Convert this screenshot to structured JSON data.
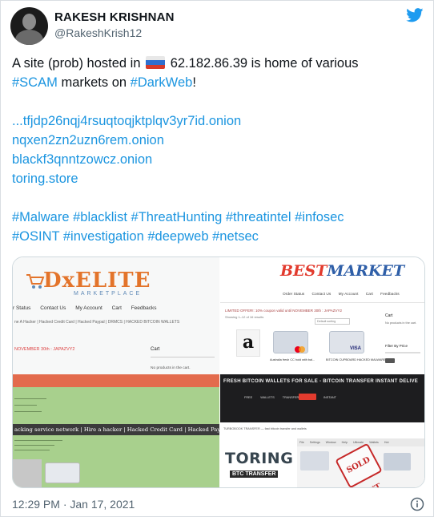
{
  "author": {
    "name": "RAKESH KRISHNAN",
    "handle": "@RakeshKrish12"
  },
  "tweet": {
    "line1_pre": "A site (prob) hosted in",
    "line1_ip": "62.182.86.39 is home of various",
    "line2_tag1": "#SCAM",
    "line2_mid": " markets on ",
    "line2_tag2": "#DarkWeb",
    "line2_end": "!",
    "links": [
      "...tfjdp26nqj4rsuqtoqjktplqv3yr7id.onion",
      "nqxen2zn2uzn6rem.onion",
      "blackf3qnntzowcz.onion",
      "toring.store"
    ],
    "hashtags_line1": "#Malware #blacklist #ThreatHunting #threatintel #infosec",
    "hashtags_line2": "#OSINT #investigation #deepweb #netsec",
    "flag_colors": [
      "#e8e8e8",
      "#2f6fcf",
      "#d63a2a"
    ]
  },
  "media": {
    "left": {
      "logo_main": "DxELITE",
      "logo_sub": "MARKETPLACE",
      "nav": [
        "r Status",
        "Contact Us",
        "My Account",
        "Cart",
        "Feedbacks"
      ],
      "subnav": "ne A Hacker | Hacked Credit Card | Hacked Paypal | DRMCS | HACKED BITCOIN WALLETS",
      "promo": "NOVEMBER 30th : JAPAZVY2",
      "cart_title": "Cart",
      "cart_note": "No products in the cart.",
      "strip_text": "acking service network | Hire a hacker | Hacked Credit Card | Hacked Paypa"
    },
    "right": {
      "logo_best": "BEST",
      "logo_market": "MARKET",
      "nav": [
        "Order Status",
        "Contact Us",
        "My Account",
        "Cart",
        "Feedbacks"
      ],
      "promo": "LIMITED OFFER!: 10% coupon valid until NOVEMBER 30th : JAPAZVY2",
      "results": "Showing 1–12 of 16 results",
      "sort": "Default sorting",
      "amazon": "a",
      "card_captions": [
        "Australia fresh CC hold with bal...",
        "BITCOIN CUPBOARD HACKED MALWARE 10K"
      ],
      "cart_title": "Cart",
      "cart_note": "No products in the cart.",
      "filter_title": "Filter By Price",
      "band_text": "FRESH BITCOIN WALLETS FOR SALE - BITCOIN TRANSFER INSTANT DELIVE",
      "band_tabs": [
        "FREE",
        "WALLETS",
        "TRANSFER",
        "SEND",
        "INSTANT"
      ],
      "sub2": "TURBOBOOK TRANSFER — fast bitcoin transfer and wallets",
      "toring_title": "TORING",
      "toring_sub": "BTC TRANSFER",
      "sold_tabs": [
        "File",
        "Settings",
        "Window",
        "Help",
        "Ultimate",
        "Wallets",
        "Hot"
      ],
      "sold_stamp": "SOLD OUT"
    }
  },
  "footer": {
    "timestamp": "12:29 PM · Jan 17, 2021"
  },
  "colors": {
    "link": "#1b95e0",
    "twitter_blue": "#1d9bf0",
    "muted": "#536471"
  },
  "icons": {
    "brand": "twitter-bird-icon",
    "info": "info-circle-icon"
  }
}
